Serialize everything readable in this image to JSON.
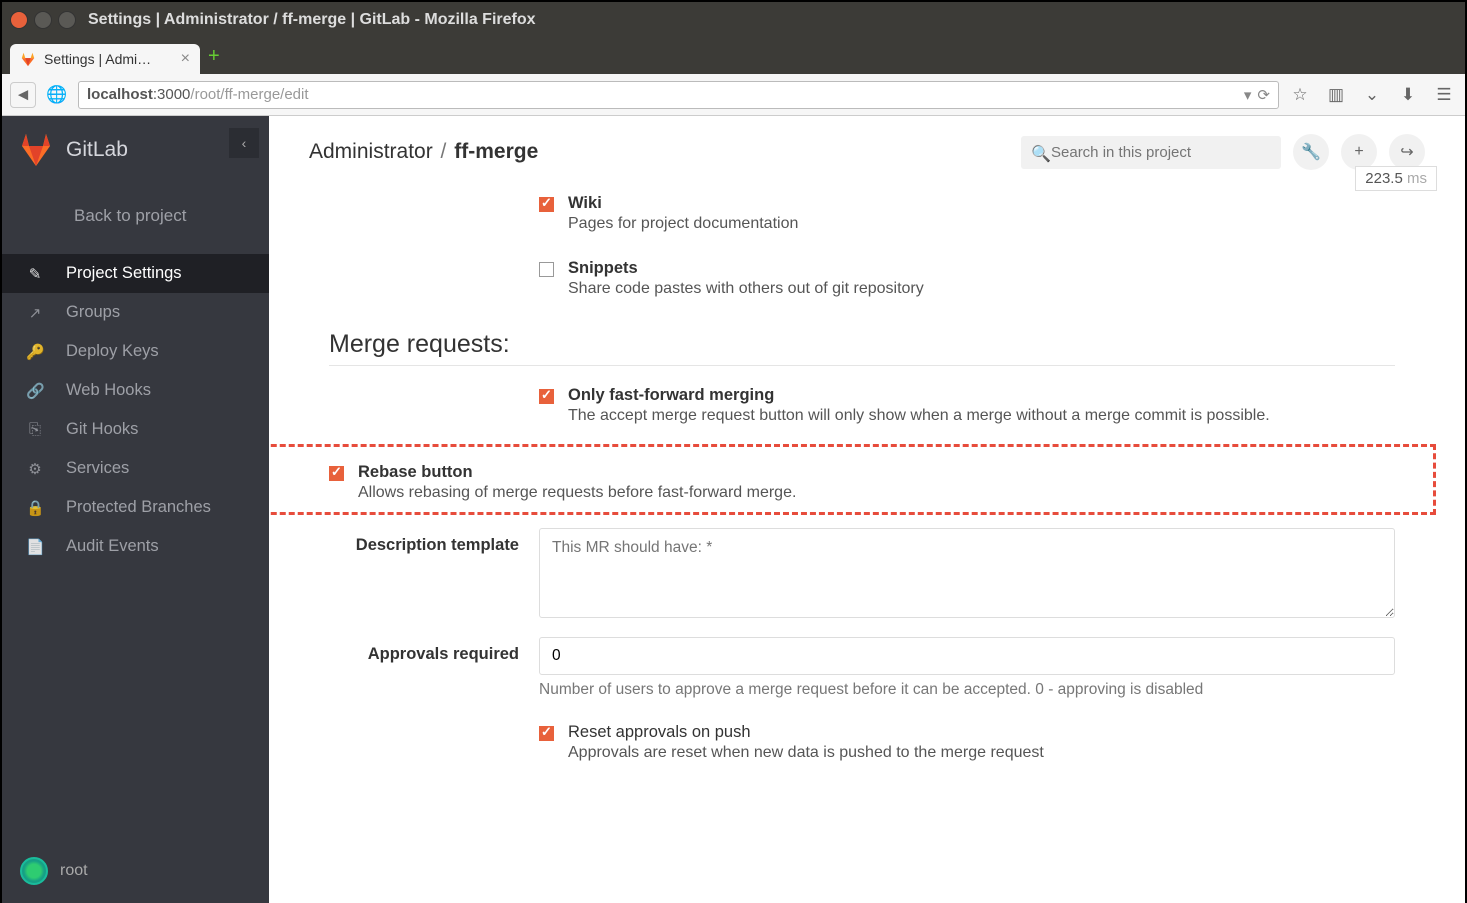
{
  "window": {
    "title": "Settings | Administrator / ff-merge | GitLab - Mozilla Firefox"
  },
  "tab": {
    "label": "Settings | Admi…"
  },
  "url": {
    "host": "localhost",
    "port": ":3000",
    "path": "/root/ff-merge/edit"
  },
  "perf": {
    "time": "223.5",
    "unit": " ms"
  },
  "sidebar": {
    "brand": "GitLab",
    "back": "Back to project",
    "items": [
      {
        "icon": "✎",
        "label": "Project Settings"
      },
      {
        "icon": "↗",
        "label": "Groups"
      },
      {
        "icon": "🔑",
        "label": "Deploy Keys"
      },
      {
        "icon": "🔗",
        "label": "Web Hooks"
      },
      {
        "icon": "⎘",
        "label": "Git Hooks"
      },
      {
        "icon": "⚙",
        "label": "Services"
      },
      {
        "icon": "🔒",
        "label": "Protected Branches"
      },
      {
        "icon": "📄",
        "label": "Audit Events"
      }
    ],
    "user": "root"
  },
  "breadcrumb": {
    "owner": "Administrator",
    "project": "ff-merge"
  },
  "search": {
    "placeholder": "Search in this project"
  },
  "wiki": {
    "title": "Wiki",
    "desc": "Pages for project documentation"
  },
  "snippets": {
    "title": "Snippets",
    "desc": "Share code pastes with others out of git repository"
  },
  "mr": {
    "heading": "Merge requests:",
    "ff": {
      "title": "Only fast-forward merging",
      "desc": "The accept merge request button will only show when a merge without a merge commit is possible."
    },
    "rebase": {
      "title": "Rebase button",
      "desc": "Allows rebasing of merge requests before fast-forward merge."
    },
    "desc_template": {
      "label": "Description template",
      "placeholder": "This MR should have: *"
    },
    "approvals": {
      "label": "Approvals required",
      "value": "0",
      "help": "Number of users to approve a merge request before it can be accepted. 0 - approving is disabled"
    },
    "reset": {
      "title": "Reset approvals on push",
      "desc": "Approvals are reset when new data is pushed to the merge request"
    }
  }
}
